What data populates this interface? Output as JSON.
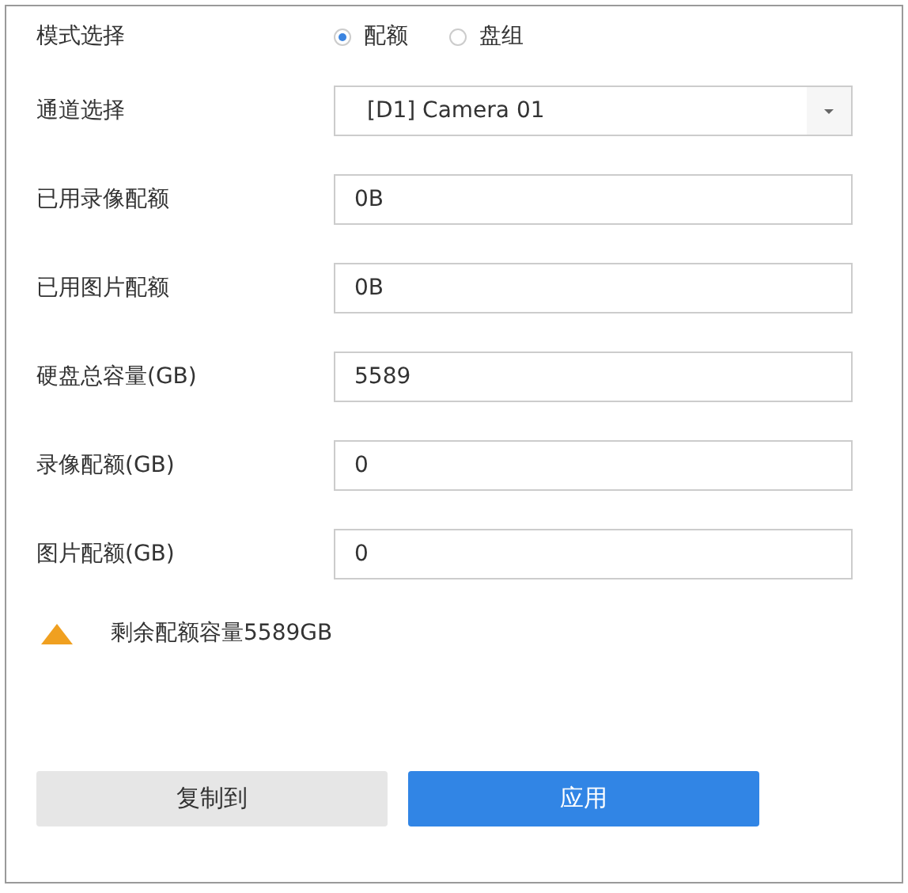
{
  "mode": {
    "label": "模式选择",
    "options": [
      {
        "label": "配额",
        "selected": true
      },
      {
        "label": "盘组",
        "selected": false
      }
    ]
  },
  "channel": {
    "label": "通道选择",
    "value": "[D1] Camera 01"
  },
  "fields": [
    {
      "label": "已用录像配额",
      "value": "0B"
    },
    {
      "label": "已用图片配额",
      "value": "0B"
    },
    {
      "label": "硬盘总容量(GB)",
      "value": "5589"
    },
    {
      "label": "录像配额(GB)",
      "value": "0"
    },
    {
      "label": "图片配额(GB)",
      "value": "0"
    }
  ],
  "warning": "剩余配额容量5589GB",
  "buttons": [
    {
      "label": "复制到",
      "kind": "secondary"
    },
    {
      "label": "应用",
      "kind": "primary"
    }
  ]
}
